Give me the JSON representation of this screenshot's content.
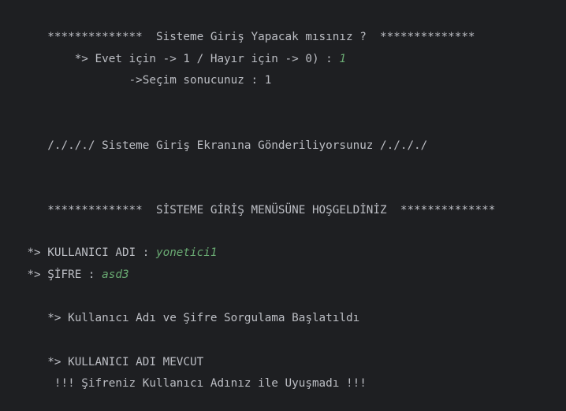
{
  "console": {
    "lines": [
      {
        "text": "   **************  Sisteme Giriş Yapacak mısınız ?  **************"
      },
      {
        "text": "       *> Evet için -> 1 / Hayır için -> 0) : ",
        "input": "1"
      },
      {
        "text": "               ->Seçim sonucunuz : 1"
      },
      {
        "text": "   /./././ Sisteme Giriş Ekranına Gönderiliyorsunuz /./././"
      },
      {
        "text": "   **************  SİSTEME GİRİŞ MENÜSÜNE HOŞGELDİNİZ  **************"
      },
      {
        "text": "*> KULLANICI ADI : ",
        "input": "yonetici1"
      },
      {
        "text": "*> ŞİFRE : ",
        "input": "asd3"
      },
      {
        "text": "   *> Kullanıcı Adı ve Şifre Sorgulama Başlatıldı"
      },
      {
        "text": "   *> KULLANICI ADI MEVCUT"
      },
      {
        "text": "    !!! Şifreniz Kullanıcı Adınız ile Uyuşmadı !!!"
      }
    ]
  },
  "colors": {
    "background": "#1e1f22",
    "text": "#bcbec4",
    "user_input": "#6aab73"
  }
}
